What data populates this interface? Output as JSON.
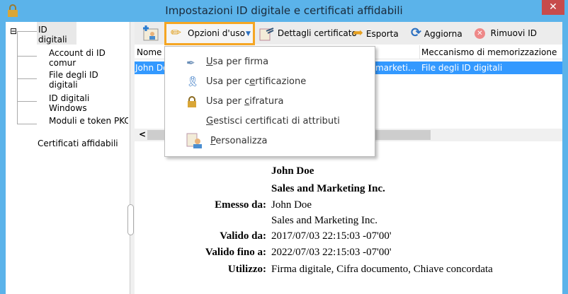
{
  "window": {
    "title": "Impostazioni ID digitale e certificati affidabili",
    "close": "✕"
  },
  "tree": {
    "root": "ID digitali",
    "expander": "⊟",
    "children": [
      "Account di ID comur",
      "File degli ID digitali",
      "ID digitali Windows",
      "Moduli e token PKCS"
    ],
    "trusted": "Certificati affidabili"
  },
  "toolbar": {
    "options": "Opzioni d'uso",
    "details": "Dettagli certificato",
    "export": "Esporta",
    "refresh": "Aggiorna",
    "remove": "Rimuovi ID"
  },
  "table": {
    "headers": [
      "Nome",
      "Meccanismo di memorizzazione"
    ],
    "row": {
      "name": "John Do",
      "issuer": "marketi...",
      "storage": "File degli ID digitali"
    }
  },
  "menu": {
    "items": [
      {
        "pre": "",
        "ul": "U",
        "post": "sa per firma"
      },
      {
        "pre": "Usa per c",
        "ul": "e",
        "post": "rtificazione"
      },
      {
        "pre": "Usa per ",
        "ul": "c",
        "post": "ifratura"
      },
      {
        "pre": "",
        "ul": "G",
        "post": "estisci certificati di attributi"
      },
      {
        "pre": "",
        "ul": "P",
        "post": "ersonalizza"
      }
    ]
  },
  "details": {
    "name": "John Doe",
    "org": "Sales and Marketing Inc.",
    "issued_by_label": "Emesso da:",
    "issued_by": "John Doe",
    "issued_by_org": "Sales and Marketing Inc.",
    "valid_from_label": "Valido da:",
    "valid_from": "2017/07/03 22:15:03 -07'00'",
    "valid_to_label": "Valido fino a:",
    "valid_to": "2022/07/03 22:15:03 -07'00'",
    "usage_label": "Utilizzo:",
    "usage": "Firma digitale, Cifra documento, Chiave concordata"
  },
  "scroll_left": "<"
}
